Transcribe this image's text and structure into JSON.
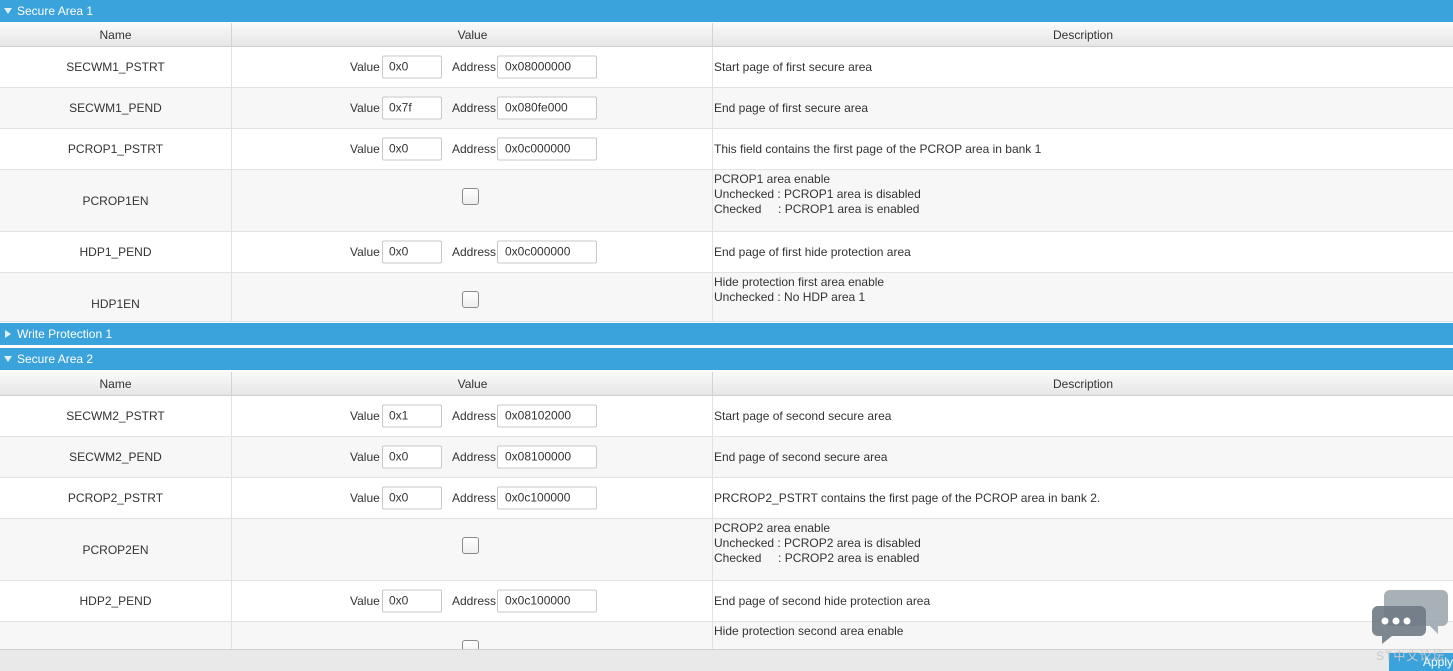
{
  "colors": {
    "accent": "#3aa3dc",
    "row_alt": "#f7f7f7"
  },
  "columns": {
    "name": "Name",
    "value": "Value",
    "description": "Description"
  },
  "field_labels": {
    "value": "Value",
    "address": "Address"
  },
  "sections": {
    "secure_area_1": {
      "title": "Secure Area 1",
      "expanded": true,
      "rows": {
        "r0": {
          "name": "SECWM1_PSTRT",
          "value": "0x0",
          "address": "0x08000000",
          "description": "Start page of first secure area"
        },
        "r1": {
          "name": "SECWM1_PEND",
          "value": "0x7f",
          "address": "0x080fe000",
          "description": "End page of first secure area"
        },
        "r2": {
          "name": "PCROP1_PSTRT",
          "value": "0x0",
          "address": "0x0c000000",
          "description": "This field contains the first page of the PCROP area in bank 1"
        },
        "r3": {
          "name": "PCROP1EN",
          "checked": false,
          "description": [
            "PCROP1 area enable",
            "",
            "Unchecked : PCROP1 area is disabled",
            "Checked     : PCROP1 area is enabled"
          ]
        },
        "r4": {
          "name": "HDP1_PEND",
          "value": "0x0",
          "address": "0x0c000000",
          "description": "End page of first hide protection area"
        },
        "r5": {
          "name": "HDP1EN",
          "checked": false,
          "description": [
            "Hide protection first area enable",
            "",
            "Unchecked : No HDP area 1"
          ]
        }
      }
    },
    "write_protection_1": {
      "title": "Write Protection 1",
      "expanded": false
    },
    "secure_area_2": {
      "title": "Secure Area 2",
      "expanded": true,
      "rows": {
        "r0": {
          "name": "SECWM2_PSTRT",
          "value": "0x1",
          "address": "0x08102000",
          "description": "Start page of second secure area"
        },
        "r1": {
          "name": "SECWM2_PEND",
          "value": "0x0",
          "address": "0x08100000",
          "description": "End page of second secure area"
        },
        "r2": {
          "name": "PCROP2_PSTRT",
          "value": "0x0",
          "address": "0x0c100000",
          "description": "PRCROP2_PSTRT contains the first page of the PCROP area in bank 2."
        },
        "r3": {
          "name": "PCROP2EN",
          "checked": false,
          "description": [
            "PCROP2 area enable",
            "",
            "Unchecked : PCROP2 area is disabled",
            "Checked     : PCROP2 area is enabled"
          ]
        },
        "r4": {
          "name": "HDP2_PEND",
          "value": "0x0",
          "address": "0x0c100000",
          "description": "End page of second hide protection area"
        },
        "r5": {
          "name": "",
          "checked": false,
          "description": [
            "Hide protection second area enable"
          ]
        }
      }
    }
  },
  "footer": {
    "apply_label": "Apply",
    "watermark": "ST中文论坛"
  },
  "icons": {
    "collapse": "triangle-down-icon",
    "expand": "triangle-right-icon",
    "chat": "chat-bubbles-icon"
  }
}
